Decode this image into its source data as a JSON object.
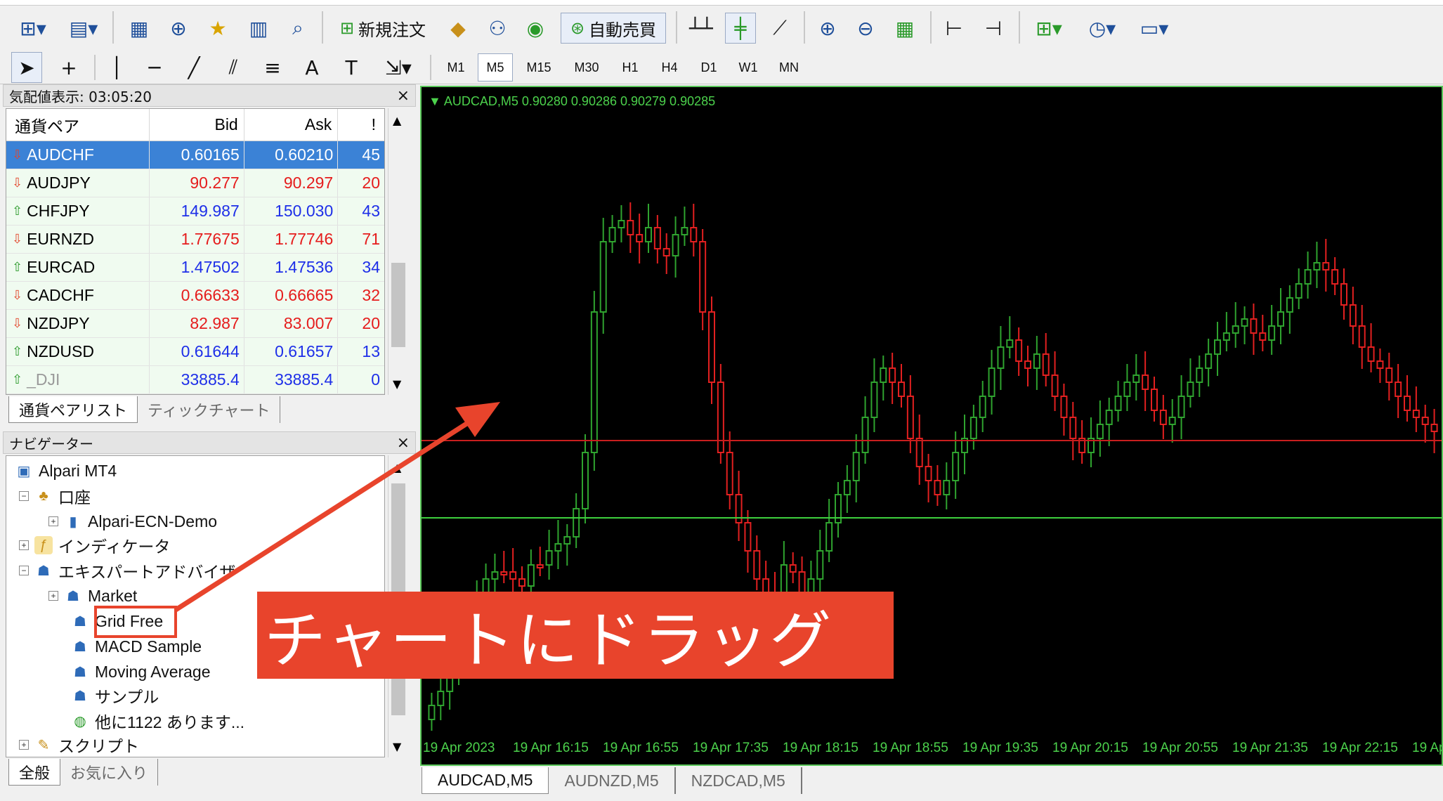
{
  "toolbar": {
    "new_order_label": "新規注文",
    "auto_trade_label": "自動売買",
    "timeframes": [
      "M1",
      "M5",
      "M15",
      "M30",
      "H1",
      "H4",
      "D1",
      "W1",
      "MN"
    ],
    "active_timeframe": "M5",
    "text_tool": "A",
    "label_tool": "T"
  },
  "market_watch": {
    "title": "気配値表示: 03:05:20",
    "columns": [
      "通貨ペア",
      "Bid",
      "Ask",
      "!"
    ],
    "rows": [
      {
        "symbol": "AUDCHF",
        "bid": "0.60165",
        "ask": "0.60210",
        "spread": "45",
        "dir": "down",
        "color": "red",
        "selected": true
      },
      {
        "symbol": "AUDJPY",
        "bid": "90.277",
        "ask": "90.297",
        "spread": "20",
        "dir": "down",
        "color": "red"
      },
      {
        "symbol": "CHFJPY",
        "bid": "149.987",
        "ask": "150.030",
        "spread": "43",
        "dir": "up",
        "color": "blue"
      },
      {
        "symbol": "EURNZD",
        "bid": "1.77675",
        "ask": "1.77746",
        "spread": "71",
        "dir": "down",
        "color": "red"
      },
      {
        "symbol": "EURCAD",
        "bid": "1.47502",
        "ask": "1.47536",
        "spread": "34",
        "dir": "up",
        "color": "blue"
      },
      {
        "symbol": "CADCHF",
        "bid": "0.66633",
        "ask": "0.66665",
        "spread": "32",
        "dir": "down",
        "color": "red"
      },
      {
        "symbol": "NZDJPY",
        "bid": "82.987",
        "ask": "83.007",
        "spread": "20",
        "dir": "down",
        "color": "red"
      },
      {
        "symbol": "NZDUSD",
        "bid": "0.61644",
        "ask": "0.61657",
        "spread": "13",
        "dir": "up",
        "color": "blue"
      },
      {
        "symbol": "_DJI",
        "bid": "33885.4",
        "ask": "33885.4",
        "spread": "0",
        "dir": "up",
        "color": "blue"
      }
    ],
    "tabs": [
      "通貨ペアリスト",
      "ティックチャート"
    ]
  },
  "navigator": {
    "title": "ナビゲーター",
    "items": {
      "root": "Alpari MT4",
      "accounts": "口座",
      "account": "Alpari-ECN-Demo",
      "indicators": "インディケータ",
      "experts": "エキスパートアドバイザ",
      "market": "Market",
      "grid_free": "Grid Free",
      "macd": "MACD Sample",
      "moving_average": "Moving Average",
      "sample": "サンプル",
      "more": "他に1122 あります...",
      "scripts": "スクリプト"
    },
    "tabs": [
      "全般",
      "お気に入り"
    ]
  },
  "chart": {
    "header": "AUDCAD,M5  0.90280 0.90286 0.90279 0.90285",
    "x_labels": [
      "19 Apr 2023",
      "19 Apr 16:15",
      "19 Apr 16:55",
      "19 Apr 17:35",
      "19 Apr 18:15",
      "19 Apr 18:55",
      "19 Apr 19:35",
      "19 Apr 20:15",
      "19 Apr 20:55",
      "19 Apr 21:35",
      "19 Apr 22:15",
      "19 Ap"
    ],
    "tabs": [
      "AUDCAD,M5",
      "AUDNZD,M5",
      "NZDCAD,M5"
    ],
    "colors": {
      "bull": "#2fa32f",
      "bear": "#e22020",
      "red_line": "#c81e1e",
      "green_line": "#3ed03e",
      "axis": "#4cd24c"
    }
  },
  "annotation": {
    "callout_text": "チャートにドラッグ",
    "color": "#e8442c"
  }
}
